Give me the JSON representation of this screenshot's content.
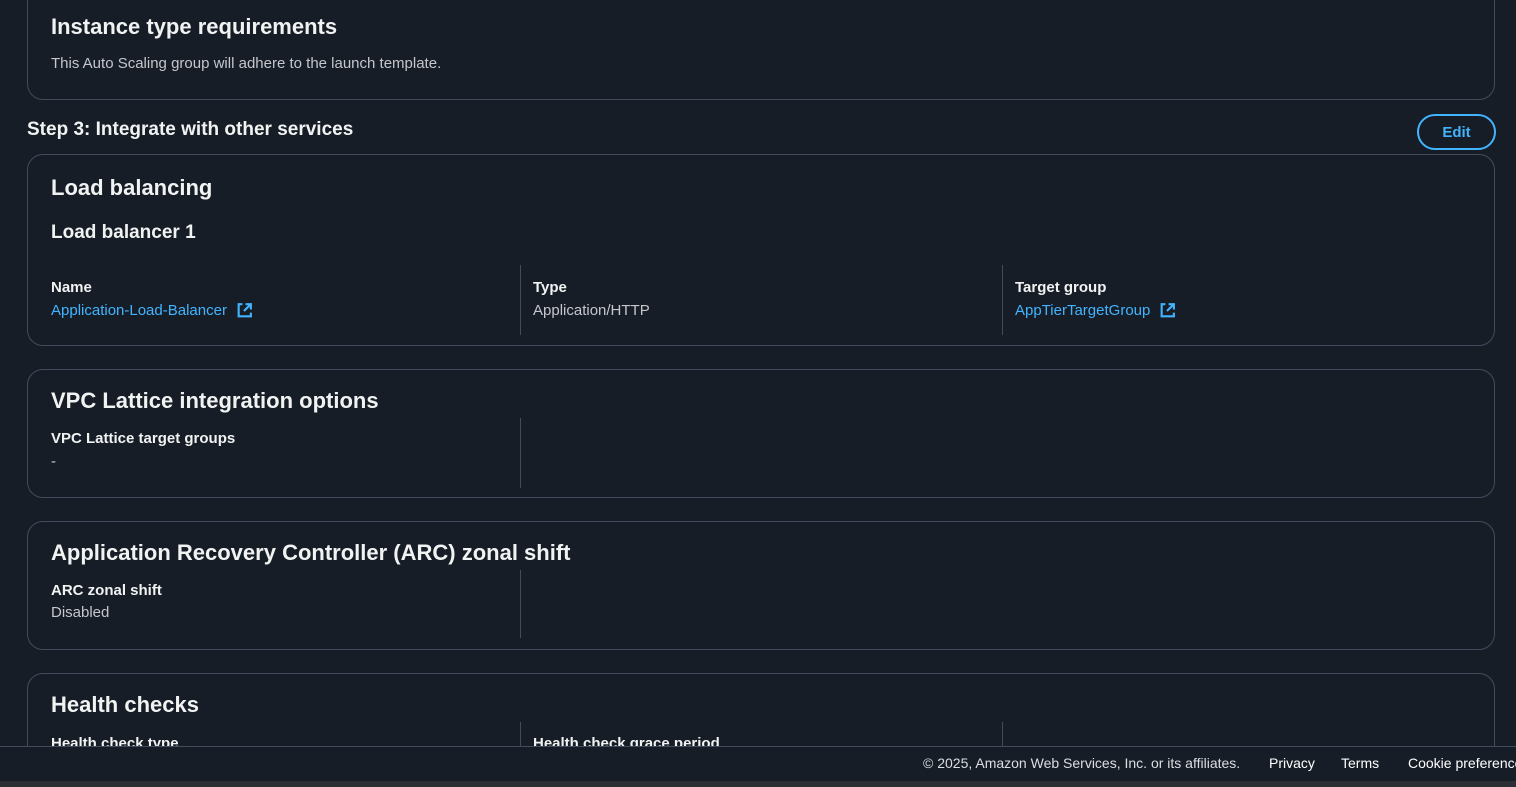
{
  "instance_requirements": {
    "title": "Instance type requirements",
    "description": "This Auto Scaling group will adhere to the launch template."
  },
  "step3": {
    "heading": "Step 3: Integrate with other services",
    "edit_label": "Edit"
  },
  "load_balancing": {
    "title": "Load balancing",
    "subtitle": "Load balancer 1",
    "name_label": "Name",
    "name_value": "Application-Load-Balancer",
    "type_label": "Type",
    "type_value": "Application/HTTP",
    "target_group_label": "Target group",
    "target_group_value": "AppTierTargetGroup"
  },
  "vpc_lattice": {
    "title": "VPC Lattice integration options",
    "target_groups_label": "VPC Lattice target groups",
    "target_groups_value": "-"
  },
  "arc": {
    "title": "Application Recovery Controller (ARC) zonal shift",
    "zonal_shift_label": "ARC zonal shift",
    "zonal_shift_value": "Disabled"
  },
  "health_checks": {
    "title": "Health checks",
    "type_label": "Health check type",
    "grace_period_label": "Health check grace period"
  },
  "footer": {
    "copyright": "© 2025, Amazon Web Services, Inc. or its affiliates.",
    "privacy": "Privacy",
    "terms": "Terms",
    "cookie": "Cookie preferences"
  },
  "colors": {
    "background": "#161d26",
    "border": "#414d5c",
    "link": "#42b4ff",
    "heading": "#f1f3f3",
    "text": "#c6c6cd"
  },
  "icons": {
    "external_link": "external-link-icon"
  }
}
